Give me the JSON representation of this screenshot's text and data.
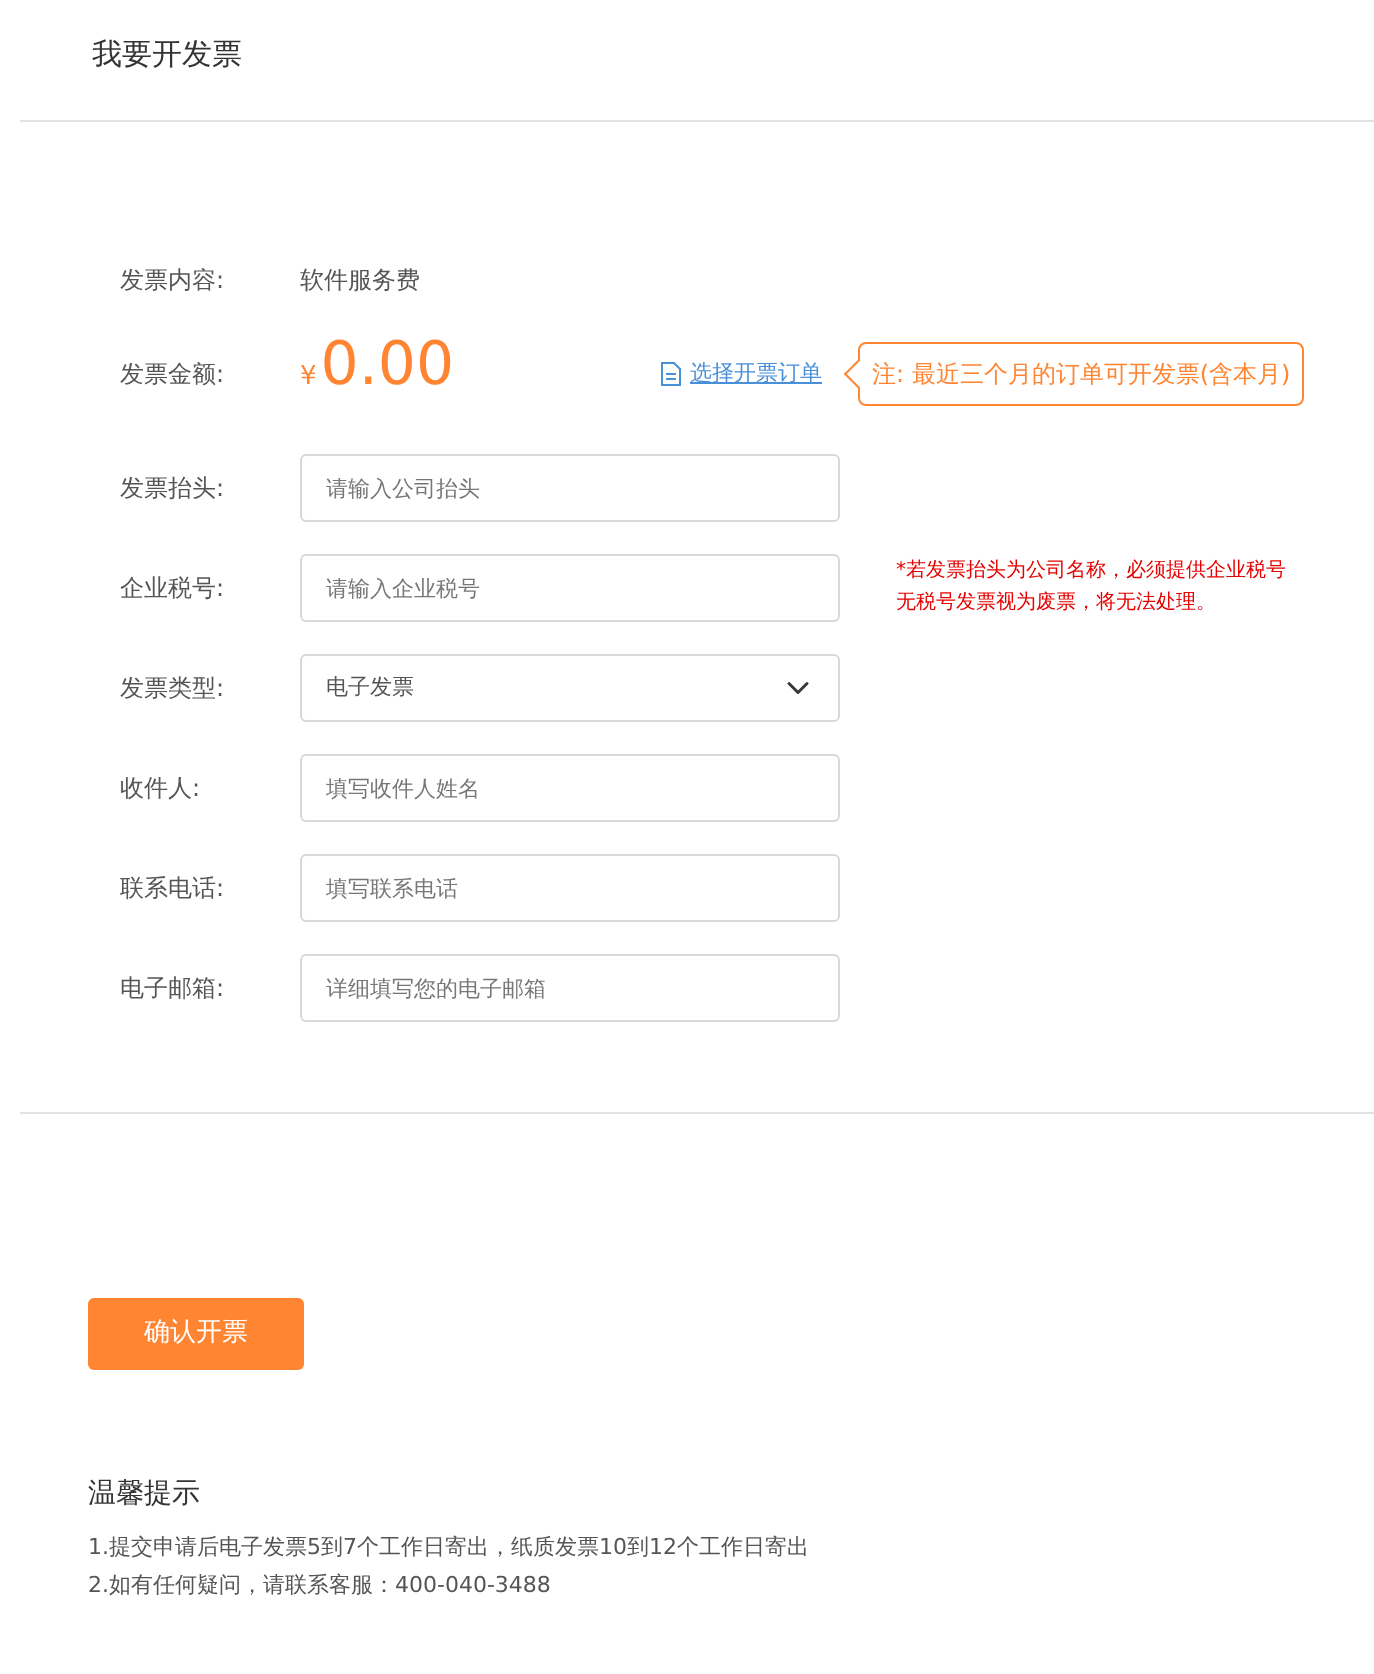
{
  "title": "我要开发票",
  "content": {
    "label": "发票内容:",
    "value": "软件服务费"
  },
  "amount": {
    "label": "发票金额:",
    "currency": "¥",
    "value": "0.00",
    "link": "选择开票订单",
    "note": "注: 最近三个月的订单可开发票(含本月)"
  },
  "fields": [
    {
      "kind": "input",
      "label": "发票抬头:",
      "placeholder": "请输入公司抬头"
    },
    {
      "kind": "input",
      "label": "企业税号:",
      "placeholder": "请输入企业税号",
      "note": [
        "*若发票抬头为公司名称，必须提供企业税号",
        "无税号发票视为废票，将无法处理。"
      ]
    },
    {
      "kind": "select",
      "label": "发票类型:",
      "value": "电子发票"
    },
    {
      "kind": "input",
      "label": "收件人:",
      "placeholder": "填写收件人姓名"
    },
    {
      "kind": "input",
      "label": "联系电话:",
      "placeholder": "填写联系电话"
    },
    {
      "kind": "input",
      "label": "电子邮箱:",
      "placeholder": "详细填写您的电子邮箱"
    }
  ],
  "submit": "确认开票",
  "tips": {
    "title": "温馨提示",
    "lines": [
      "1.提交申请后电子发票5到7个工作日寄出，纸质发票10到12个工作日寄出",
      "2.如有任何疑问，请联系客服：400-040-3488"
    ]
  }
}
